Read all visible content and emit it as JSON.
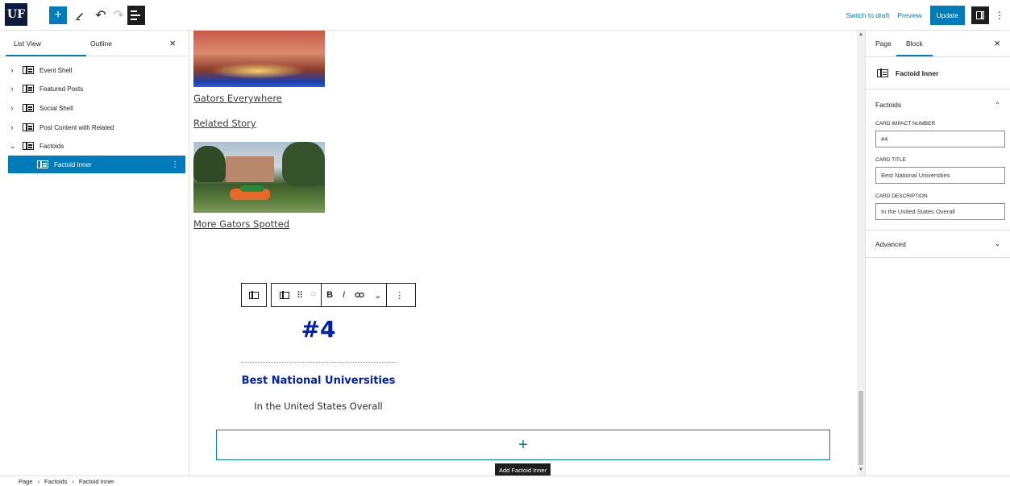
{
  "header": {
    "logo": "UF",
    "add_icon": "plus-icon",
    "tools_icon": "pencil-icon",
    "undo_icon": "undo-icon",
    "redo_icon": "redo-icon",
    "list_view_icon": "list-view-icon",
    "switch_to_draft": "Switch to draft",
    "preview": "Preview",
    "update": "Update",
    "settings_icon": "sidebar-toggle-icon",
    "options_icon": "kebab-icon"
  },
  "list_view": {
    "tabs": [
      "List View",
      "Outline"
    ],
    "close": "×",
    "items": [
      {
        "label": "Event Shell",
        "chevron": "›"
      },
      {
        "label": "Featured Posts",
        "chevron": "›"
      },
      {
        "label": "Social Shell",
        "chevron": "›"
      },
      {
        "label": "Post Content with Related",
        "chevron": "›"
      },
      {
        "label": "Factoids",
        "chevron": "⌄"
      },
      {
        "label": "Factoid Inner",
        "chevron": ""
      }
    ],
    "more": "⋮"
  },
  "canvas": {
    "links": [
      "Gators Everywhere",
      "Related Story",
      "More Gators Spotted"
    ],
    "toolbar": {
      "bold": "B",
      "italic": "I",
      "link_icon": "link-icon",
      "chevron": "⌄",
      "more": "⋮",
      "drag": "⠿"
    },
    "factoid": {
      "number": "#4",
      "title": "Best National Universities",
      "description": "In the United States Overall"
    },
    "appender": "+",
    "tooltip": "Add Factoid Inner"
  },
  "settings": {
    "tabs": [
      "Page",
      "Block"
    ],
    "close": "×",
    "block_name": "Factoid Inner",
    "section_title": "Factoids",
    "fields": [
      {
        "label": "CARD IMPACT NUMBER",
        "value": "#4"
      },
      {
        "label": "CARD TITLE",
        "value": "Best National Universities"
      },
      {
        "label": "CARD DESCRIPTION",
        "value": "In the United States Overall"
      }
    ],
    "advanced": "Advanced",
    "chevron_up": "⌃",
    "chevron_down": "⌄"
  },
  "breadcrumb": [
    "Page",
    "Factoids",
    "Factoid Inner"
  ],
  "breadcrumb_sep": "›",
  "colors": {
    "accent": "#007cba",
    "uf_blue": "#0021a5",
    "uf_orange": "#e8622a"
  }
}
